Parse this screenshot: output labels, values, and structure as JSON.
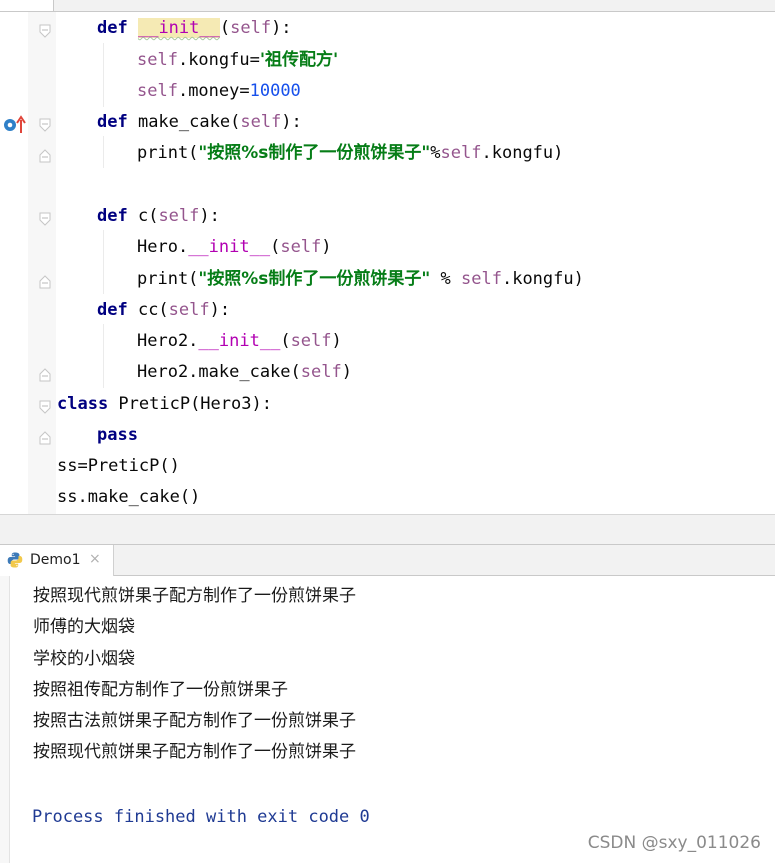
{
  "editor": {
    "lines": [
      [
        {
          "t": "def",
          "c": "kw"
        },
        {
          "t": " "
        },
        {
          "t": "__init__",
          "c": "dunder hl wavy"
        },
        {
          "t": "("
        },
        {
          "t": "self",
          "c": "selfc"
        },
        {
          "t": "):"
        }
      ],
      [
        {
          "t": "self",
          "c": "selfc"
        },
        {
          "t": ".kongfu="
        },
        {
          "t": "'祖传配方'",
          "c": "str"
        }
      ],
      [
        {
          "t": "self",
          "c": "selfc"
        },
        {
          "t": ".money="
        },
        {
          "t": "10000",
          "c": "num"
        }
      ],
      [
        {
          "t": "def",
          "c": "kw"
        },
        {
          "t": " make_cake"
        },
        {
          "t": "("
        },
        {
          "t": "self",
          "c": "selfc"
        },
        {
          "t": "):"
        }
      ],
      [
        {
          "t": "print("
        },
        {
          "t": "\"按照%s制作了一份煎饼果子\"",
          "c": "str"
        },
        {
          "t": "%"
        },
        {
          "t": "self",
          "c": "selfc"
        },
        {
          "t": ".kongfu)"
        }
      ],
      [],
      [
        {
          "t": "def",
          "c": "kw"
        },
        {
          "t": " c("
        },
        {
          "t": "self",
          "c": "selfc"
        },
        {
          "t": "):"
        }
      ],
      [
        {
          "t": "Hero."
        },
        {
          "t": "__init__",
          "c": "dunder"
        },
        {
          "t": "("
        },
        {
          "t": "self",
          "c": "selfc"
        },
        {
          "t": ")"
        }
      ],
      [
        {
          "t": "print("
        },
        {
          "t": "\"按照%s制作了一份煎饼果子\"",
          "c": "str"
        },
        {
          "t": " % "
        },
        {
          "t": "self",
          "c": "selfc"
        },
        {
          "t": ".kongfu)"
        }
      ],
      [
        {
          "t": "def",
          "c": "kw"
        },
        {
          "t": " cc("
        },
        {
          "t": "self",
          "c": "selfc"
        },
        {
          "t": "):"
        }
      ],
      [
        {
          "t": "Hero2."
        },
        {
          "t": "__init__",
          "c": "dunder"
        },
        {
          "t": "("
        },
        {
          "t": "self",
          "c": "selfc"
        },
        {
          "t": ")"
        }
      ],
      [
        {
          "t": "Hero2.make_cake("
        },
        {
          "t": "self",
          "c": "selfc"
        },
        {
          "t": ")"
        }
      ],
      [
        {
          "t": "class",
          "c": "kw"
        },
        {
          "t": " PreticP(Hero3):"
        }
      ],
      [
        {
          "t": "pass",
          "c": "kw"
        }
      ],
      [
        {
          "t": "ss=PreticP()"
        }
      ],
      [
        {
          "t": "ss.make_cake()"
        }
      ]
    ]
  },
  "run_panel": {
    "tab_label": "Demo1",
    "close_glyph": "×",
    "output": [
      "按照现代煎饼果子配方制作了一份煎饼果子",
      "师傅的大烟袋",
      "学校的小烟袋",
      "按照祖传配方制作了一份煎饼果子",
      "按照古法煎饼果子配方制作了一份煎饼果子",
      "按照现代煎饼果子配方制作了一份煎饼果子"
    ],
    "exit_message": "Process finished with exit code 0"
  },
  "watermark": "CSDN @sxy_011026",
  "icons": {
    "fold_marker": "fold-marker-icon",
    "override_gutter": "override-method-icon",
    "python_file": "python-file-icon"
  },
  "colors": {
    "keyword": "#000080",
    "self": "#94558d",
    "string": "#067d17",
    "number": "#1750eb",
    "dunder": "#b200b2",
    "exit_text": "#1f3a93"
  }
}
